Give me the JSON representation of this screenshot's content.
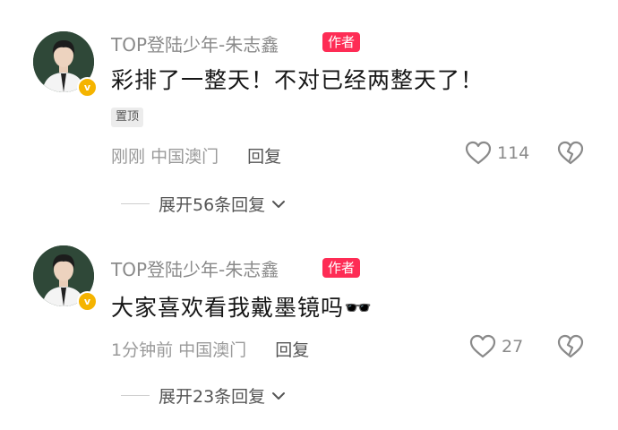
{
  "comments": [
    {
      "username": "TOP登陆少年-朱志鑫",
      "author_badge": "作者",
      "verified_badge": "v",
      "text": "彩排了一整天！不对已经两整天了！",
      "pinned_label": "置顶",
      "time": "刚刚",
      "location": "中国澳门",
      "reply_label": "回复",
      "likes": "114",
      "expand_label": "展开56条回复"
    },
    {
      "username": "TOP登陆少年-朱志鑫",
      "author_badge": "作者",
      "verified_badge": "v",
      "text": "大家喜欢看我戴墨镜吗🕶️",
      "time": "1分钟前",
      "location": "中国澳门",
      "reply_label": "回复",
      "likes": "27",
      "expand_label": "展开23条回复"
    }
  ],
  "icons": {
    "like": "heart-outline-icon",
    "dislike": "broken-heart-icon",
    "expand": "chevron-down-icon"
  },
  "colors": {
    "author_badge": "#fe2c55",
    "verified": "#f5b400"
  }
}
